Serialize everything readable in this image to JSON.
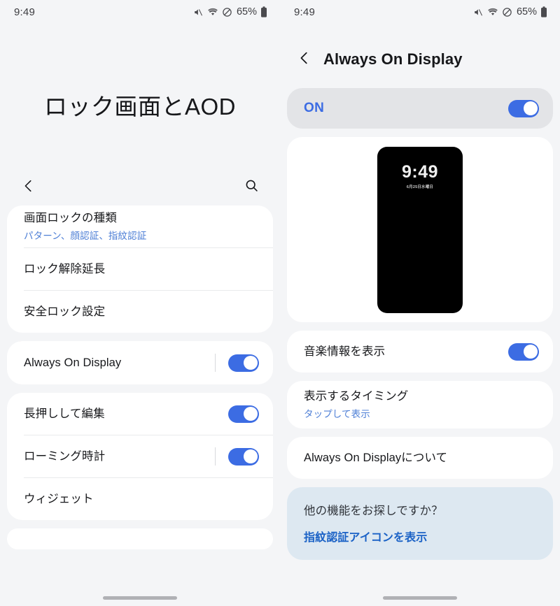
{
  "status_bar": {
    "time": "9:49",
    "battery_percent": "65%",
    "icons": [
      "mute-icon",
      "wifi-icon",
      "do-not-disturb-icon",
      "battery-icon"
    ]
  },
  "colors": {
    "accent_blue": "#3c6ce3",
    "link_blue": "#1b62c6",
    "sub_blue": "#4e7fd6",
    "annotation_red": "#f42a05",
    "panel_bg": "#f4f5f7",
    "card_bg": "#ffffff",
    "master_bg": "#e3e4e7",
    "info_bg": "#dde8f1"
  },
  "left_panel": {
    "title": "ロック画面とAOD",
    "toolbar": {
      "back_icon": "chevron-left-icon",
      "search_icon": "search-icon"
    },
    "group1": [
      {
        "title": "画面ロックの種類",
        "subtitle": "パターン、顔認証、指紋認証",
        "toggle": null
      },
      {
        "title": "ロック解除延長",
        "subtitle": null,
        "toggle": null
      },
      {
        "title": "安全ロック設定",
        "subtitle": null,
        "toggle": null
      }
    ],
    "group2": [
      {
        "title": "Always On Display",
        "subtitle": null,
        "toggle": "on",
        "toggle_separator": true,
        "annotated": true
      }
    ],
    "group3": [
      {
        "title": "長押しして編集",
        "subtitle": null,
        "toggle": "on",
        "toggle_separator": false
      },
      {
        "title": "ローミング時計",
        "subtitle": null,
        "toggle": "on",
        "toggle_separator": true
      },
      {
        "title": "ウィジェット",
        "subtitle": null,
        "toggle": null
      }
    ]
  },
  "right_panel": {
    "header": {
      "back_icon": "chevron-left-icon",
      "title": "Always On Display"
    },
    "master_switch": {
      "label": "ON",
      "state": "on"
    },
    "preview": {
      "clock": "9:49",
      "date": "6月25日水曜日"
    },
    "group1": [
      {
        "title": "音楽情報を表示",
        "subtitle": null,
        "toggle": "on"
      }
    ],
    "group2": [
      {
        "title": "表示するタイミング",
        "subtitle": "タップして表示",
        "toggle": null
      }
    ],
    "group3": [
      {
        "title": "Always On Displayについて",
        "subtitle": null,
        "toggle": null
      }
    ],
    "info_card": {
      "title": "他の機能をお探しですか？",
      "link": "指紋認証アイコンを表示"
    }
  }
}
